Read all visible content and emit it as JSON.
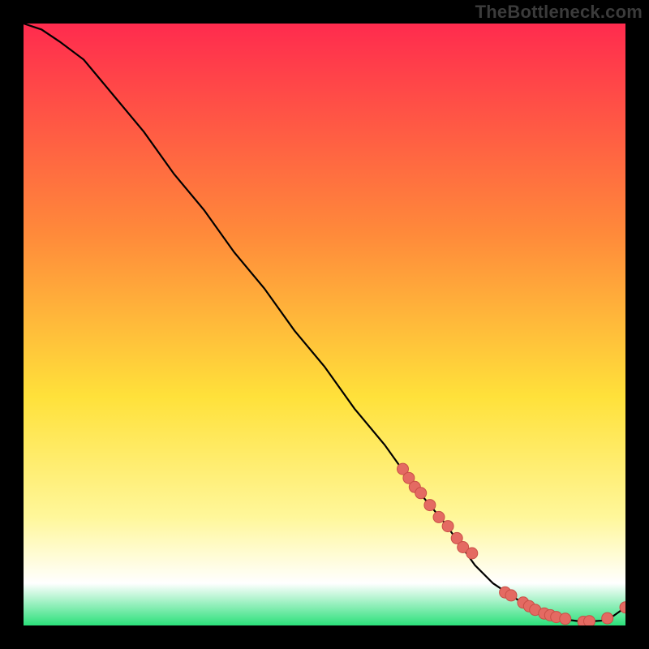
{
  "watermark": "TheBottleneck.com",
  "colors": {
    "gradient_top": "#ff2b4e",
    "gradient_mid1": "#ff8a3a",
    "gradient_mid2": "#ffe13a",
    "gradient_mid3": "#fff79a",
    "gradient_bottom_edge": "#2be07a",
    "curve": "#000000",
    "marker_fill": "#e46a62",
    "marker_stroke": "#c94f47"
  },
  "chart_data": {
    "type": "line",
    "title": "",
    "xlabel": "",
    "ylabel": "",
    "xlim": [
      0,
      100
    ],
    "ylim": [
      0,
      100
    ],
    "series": [
      {
        "name": "bottleneck-curve",
        "x": [
          0,
          3,
          6,
          10,
          15,
          20,
          25,
          30,
          35,
          40,
          45,
          50,
          55,
          60,
          65,
          70,
          75,
          78,
          81,
          84,
          87,
          90,
          93,
          96,
          98,
          100
        ],
        "y": [
          100,
          99,
          97,
          94,
          88,
          82,
          75,
          69,
          62,
          56,
          49,
          43,
          36,
          30,
          23,
          17,
          10,
          7,
          5,
          3,
          2,
          1,
          0.6,
          0.8,
          1.6,
          3
        ]
      }
    ],
    "markers": {
      "name": "highlighted-points",
      "x": [
        63,
        64,
        65,
        66,
        67.5,
        69,
        70.5,
        72,
        73,
        74.5,
        80,
        81,
        83,
        84,
        85,
        86.5,
        87.5,
        88.5,
        90,
        93,
        94,
        97,
        100
      ],
      "y": [
        26,
        24.5,
        23,
        22,
        20,
        18,
        16.5,
        14.5,
        13,
        12,
        5.5,
        5,
        3.8,
        3.2,
        2.6,
        2,
        1.7,
        1.4,
        1.1,
        0.6,
        0.7,
        1.2,
        3
      ]
    }
  }
}
